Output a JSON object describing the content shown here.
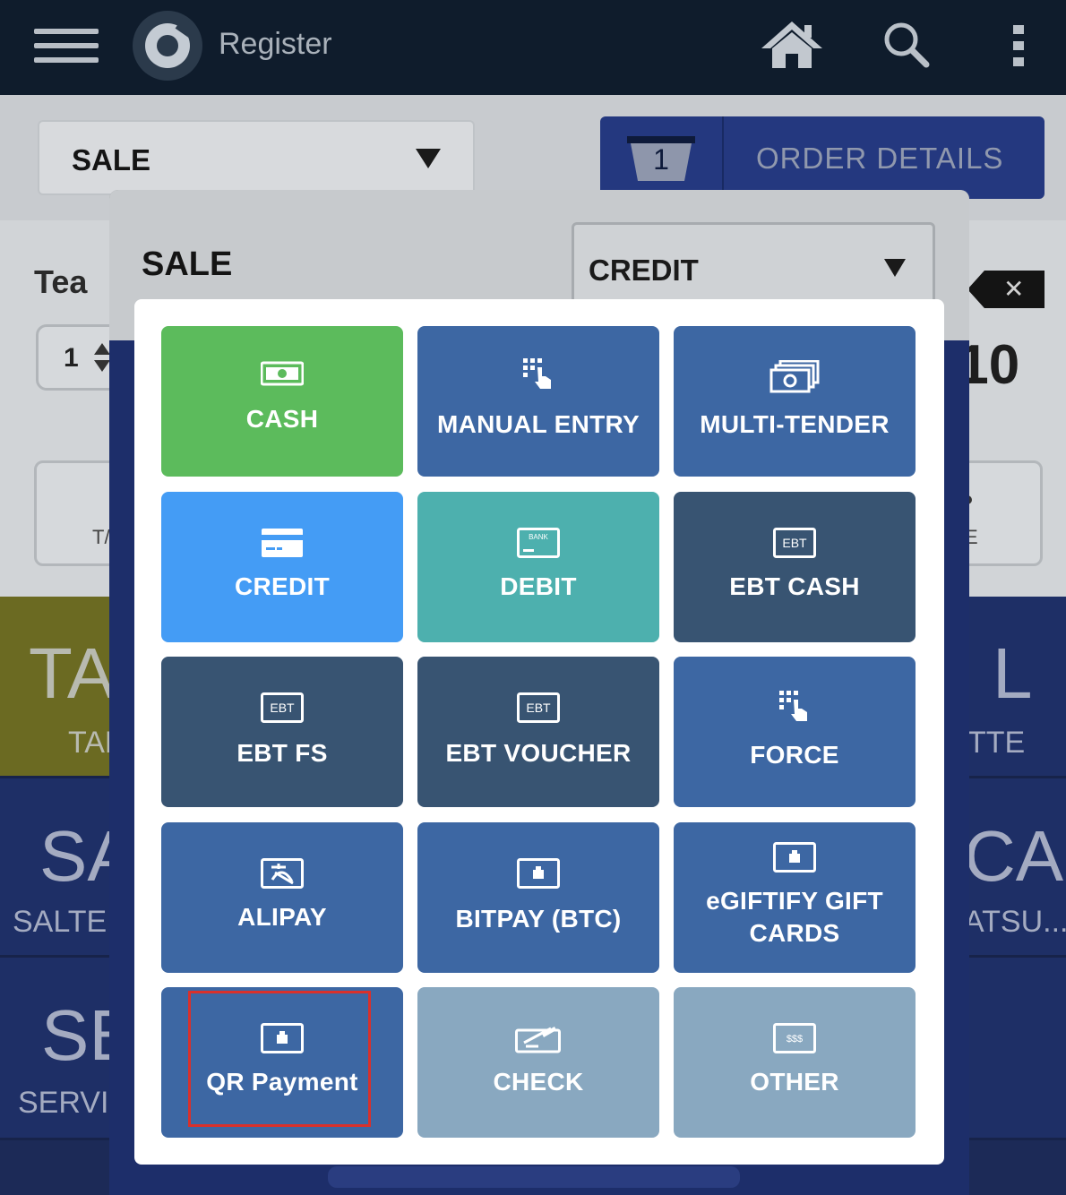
{
  "app": {
    "title": "Register",
    "icons": [
      "hamburger-menu-icon",
      "app-logo-icon",
      "home-icon",
      "search-icon",
      "more-vertical-icon"
    ]
  },
  "register": {
    "transaction_type": "SALE",
    "order": {
      "count": "1",
      "label": "ORDER DETAILS"
    },
    "item_name": "Tea",
    "quantity": "1",
    "price_fragment": ".10",
    "left_card_fragment": "T/",
    "right_card_fragment": "E",
    "tiles": [
      {
        "big": "TA",
        "small": "TAK"
      },
      {
        "big": "L",
        "small": "TTE"
      },
      {
        "big": "SA",
        "small": "SALTED"
      },
      {
        "big": "CA",
        "small": "ATSU..."
      },
      {
        "big": "SE",
        "small": "SERVIC"
      }
    ]
  },
  "sale_panel": {
    "title": "SALE",
    "payment_method": "CREDIT"
  },
  "tender_options": [
    {
      "id": "cash",
      "label": "CASH",
      "icon": "cash-bill-icon",
      "color": "#5cbb5c"
    },
    {
      "id": "manual-entry",
      "label": "MANUAL ENTRY",
      "icon": "keypad-touch-icon",
      "color": "#3d67a3"
    },
    {
      "id": "multi-tender",
      "label": "MULTI-TENDER",
      "icon": "stacked-bills-icon",
      "color": "#3d67a3"
    },
    {
      "id": "credit",
      "label": "CREDIT",
      "icon": "credit-card-icon",
      "color": "#449cf5"
    },
    {
      "id": "debit",
      "label": "DEBIT",
      "icon": "bank-card-icon",
      "icon_text": "BANK",
      "color": "#4db0ae"
    },
    {
      "id": "ebt-cash",
      "label": "EBT CASH",
      "icon": "ebt-card-icon",
      "icon_text": "EBT",
      "color": "#385472"
    },
    {
      "id": "ebt-fs",
      "label": "EBT FS",
      "icon": "ebt-card-icon",
      "icon_text": "EBT",
      "color": "#385472"
    },
    {
      "id": "ebt-voucher",
      "label": "EBT VOUCHER",
      "icon": "ebt-card-icon",
      "icon_text": "EBT",
      "color": "#385472"
    },
    {
      "id": "force",
      "label": "FORCE",
      "icon": "keypad-touch-icon",
      "color": "#3d67a3"
    },
    {
      "id": "alipay",
      "label": "ALIPAY",
      "icon": "alipay-icon",
      "color": "#3d67a3"
    },
    {
      "id": "bitpay",
      "label": "BITPAY (BTC)",
      "icon": "gift-card-icon",
      "color": "#3d67a3"
    },
    {
      "id": "egiftify",
      "label": "eGIFTIFY GIFT CARDS",
      "icon": "gift-card-icon",
      "color": "#3d67a3"
    },
    {
      "id": "qr-payment",
      "label": "QR Payment",
      "icon": "gift-card-icon",
      "color": "#3d67a3",
      "highlighted": true
    },
    {
      "id": "check",
      "label": "CHECK",
      "icon": "check-cheque-icon",
      "color": "#89a8c0"
    },
    {
      "id": "other",
      "label": "OTHER",
      "icon": "other-money-icon",
      "icon_text": "$$$",
      "color": "#89a8c0"
    }
  ],
  "highlight_color": "#d9302b"
}
